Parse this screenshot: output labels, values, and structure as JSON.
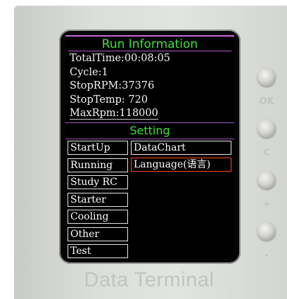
{
  "run_info": {
    "title": "Run Information",
    "lines": [
      "TotalTime:00:08:05",
      "Cycle:1",
      "StopRPM:37376",
      "StopTemp: 720",
      "MaxRpm:118000"
    ]
  },
  "setting": {
    "title": "Setting",
    "left_menu": [
      "StartUp",
      "Running",
      "Study RC",
      "Starter",
      "Cooling",
      "Other",
      "Test"
    ],
    "right_menu": [
      "DataChart",
      "Language(语言)"
    ],
    "selected": "Language(语言)"
  },
  "hardware_buttons": [
    {
      "label": "OK"
    },
    {
      "label": "C"
    },
    {
      "label": "+"
    },
    {
      "label": "-"
    }
  ],
  "brand": "Data Terminal",
  "colors": {
    "title_green": "#3fe03c",
    "divider_purple": "#b35bc9",
    "selection_orange": "#ff4a1a",
    "screen_bg": "#000000",
    "case_grey": "#dcdedb"
  }
}
